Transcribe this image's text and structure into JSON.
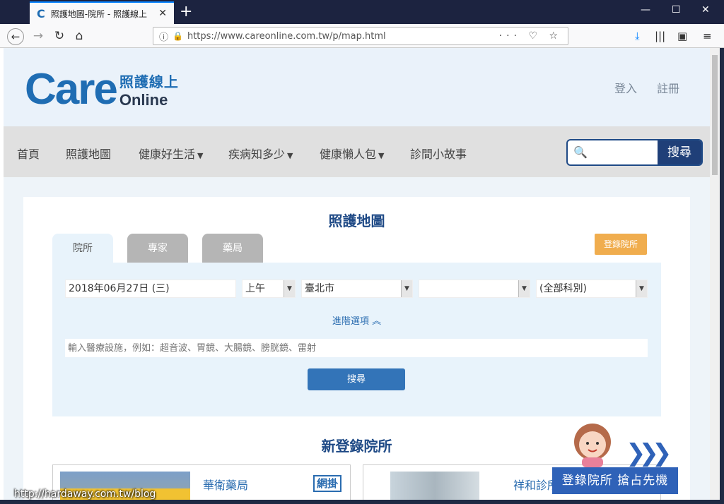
{
  "browser": {
    "tab_title": "照護地圖-院所 - 照護線上",
    "tab_favicon": "C",
    "url": "https://www.careonline.com.tw/p/map.html"
  },
  "header": {
    "logo_main": "Care",
    "logo_zh": "照護線上",
    "logo_en": "Online",
    "login": "登入",
    "register": "註冊"
  },
  "menu": {
    "items": [
      "首頁",
      "照護地圖",
      "健康好生活",
      "疾病知多少",
      "健康懶人包",
      "診間小故事"
    ],
    "search_button": "搜尋",
    "search_placeholder": ""
  },
  "map": {
    "title": "照護地圖",
    "tabs": [
      "院所",
      "專家",
      "藥局"
    ],
    "register_clinic": "登錄院所",
    "date": "2018年06月27日 (三)",
    "period": "上午",
    "city": "臺北市",
    "district": "",
    "department": "(全部科別)",
    "advanced": "進階選項",
    "keyword_placeholder": "輸入醫療設施，例如：超音波、胃鏡、大腸鏡、膀胱鏡、雷射",
    "search_button": "搜尋"
  },
  "listing": {
    "title": "新登錄院所",
    "cards": [
      {
        "name": "華衛藥局",
        "tag": "網掛"
      },
      {
        "name": "祥和診所",
        "tag": ""
      }
    ]
  },
  "promo": {
    "text": "登錄院所  搶占先機"
  },
  "watermark": "http://hardaway.com.tw/blog",
  "colors": {
    "brand": "#1f6db3",
    "nav_dark": "#1f3f78",
    "accent": "#f0ad4e",
    "button": "#3374b8"
  }
}
